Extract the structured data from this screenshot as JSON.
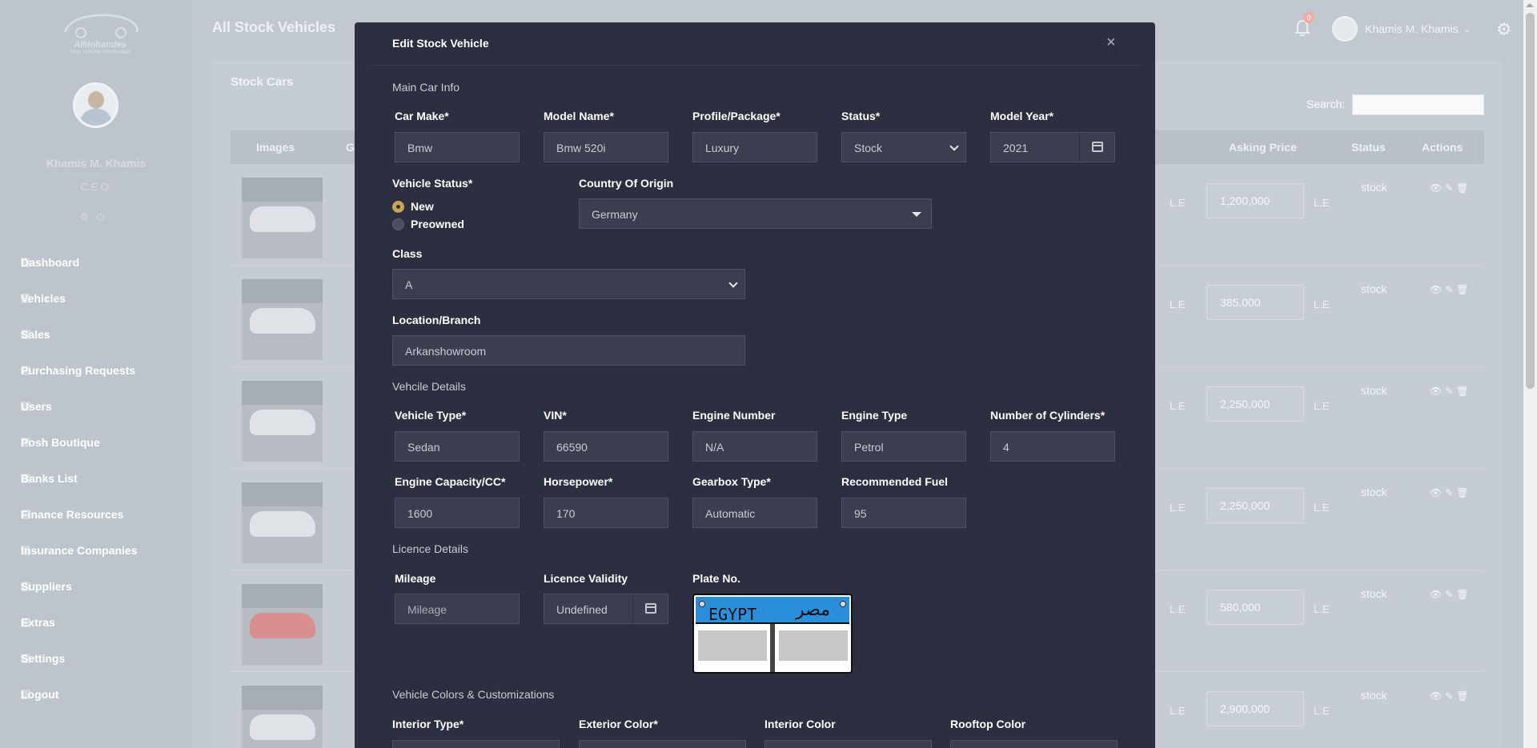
{
  "sidebar": {
    "logo_title": "AlMohandes",
    "logo_sub": "Your Vehicle Destination",
    "user_name": "Khamis M. Khamis",
    "user_role": "C.E.O.",
    "menu": [
      {
        "label": "Dashboard",
        "chevron": ""
      },
      {
        "label": "Vehicles",
        "chevron": "›"
      },
      {
        "label": "Sales",
        "chevron": "›"
      },
      {
        "label": "Purchasing Requests",
        "chevron": "›"
      },
      {
        "label": "Users",
        "chevron": "›"
      },
      {
        "label": "Posh Boutique",
        "chevron": "›"
      },
      {
        "label": "Banks List",
        "chevron": "›"
      },
      {
        "label": "Finance Resources",
        "chevron": "›"
      },
      {
        "label": "Insurance Companies",
        "chevron": "›"
      },
      {
        "label": "Suppliers",
        "chevron": "›"
      },
      {
        "label": "Extras",
        "chevron": "›"
      },
      {
        "label": "Settings",
        "chevron": "›"
      },
      {
        "label": "Logout",
        "chevron": ""
      }
    ]
  },
  "topbar": {
    "title": "All Stock Vehicles",
    "notification_count": "0",
    "user_name": "Khamis M. Khamis"
  },
  "page": {
    "card_title": "Stock Cars",
    "search_label": "Search:",
    "columns": {
      "images": "Images",
      "g": "G",
      "asking_price": "Asking Price",
      "status": "Status",
      "actions": "Actions"
    },
    "currency": "L.E",
    "rows": [
      {
        "price": "1,200,000",
        "status": "stock"
      },
      {
        "price": "385,000",
        "status": "stock"
      },
      {
        "price": "2,250,000",
        "status": "stock"
      },
      {
        "price": "2,250,000",
        "status": "stock"
      },
      {
        "price": "580,000",
        "status": "stock"
      },
      {
        "price": "2,900,000",
        "status": "stock"
      }
    ]
  },
  "modal": {
    "title": "Edit Stock Vehicle",
    "close": "×",
    "sections": {
      "main": "Main Car Info",
      "details": "Vehcile Details",
      "licence": "Licence Details",
      "colors": "Vehicle Colors & Customizations"
    },
    "labels": {
      "car_make": "Car Make*",
      "model_name": "Model Name*",
      "profile": "Profile/Package*",
      "status": "Status*",
      "model_year": "Model Year*",
      "vehicle_status": "Vehicle Status*",
      "country": "Country Of Origin",
      "class": "Class",
      "location": "Location/Branch",
      "vehicle_type": "Vehicle Type*",
      "vin": "VIN*",
      "engine_number": "Engine Number",
      "engine_type": "Engine Type",
      "cylinders": "Number of Cylinders*",
      "capacity": "Engine Capacity/CC*",
      "horsepower": "Horsepower*",
      "gearbox": "Gearbox Type*",
      "fuel": "Recommended Fuel",
      "mileage": "Mileage",
      "licence_validity": "Licence Validity",
      "plate": "Plate No.",
      "interior_type": "Interior Type*",
      "exterior_color": "Exterior Color*",
      "interior_color": "Interior Color",
      "rooftop_color": "Rooftop Color"
    },
    "values": {
      "car_make": "Bmw",
      "model_name": "Bmw 520i",
      "profile": "Luxury",
      "status": "Stock",
      "model_year": "2021",
      "vehicle_status_new": "New",
      "vehicle_status_preowned": "Preowned",
      "country": "Germany",
      "class": "A",
      "location": "Arkanshowroom",
      "vehicle_type": "Sedan",
      "vin": "66590",
      "engine_number": "N/A",
      "engine_type": "Petrol",
      "cylinders": "4",
      "capacity": "1600",
      "horsepower": "170",
      "gearbox": "Automatic",
      "fuel": "95",
      "mileage_placeholder": "Mileage",
      "licence_validity": "Undefined"
    },
    "plate": {
      "en": "EGYPT",
      "ar": "مصر"
    }
  }
}
